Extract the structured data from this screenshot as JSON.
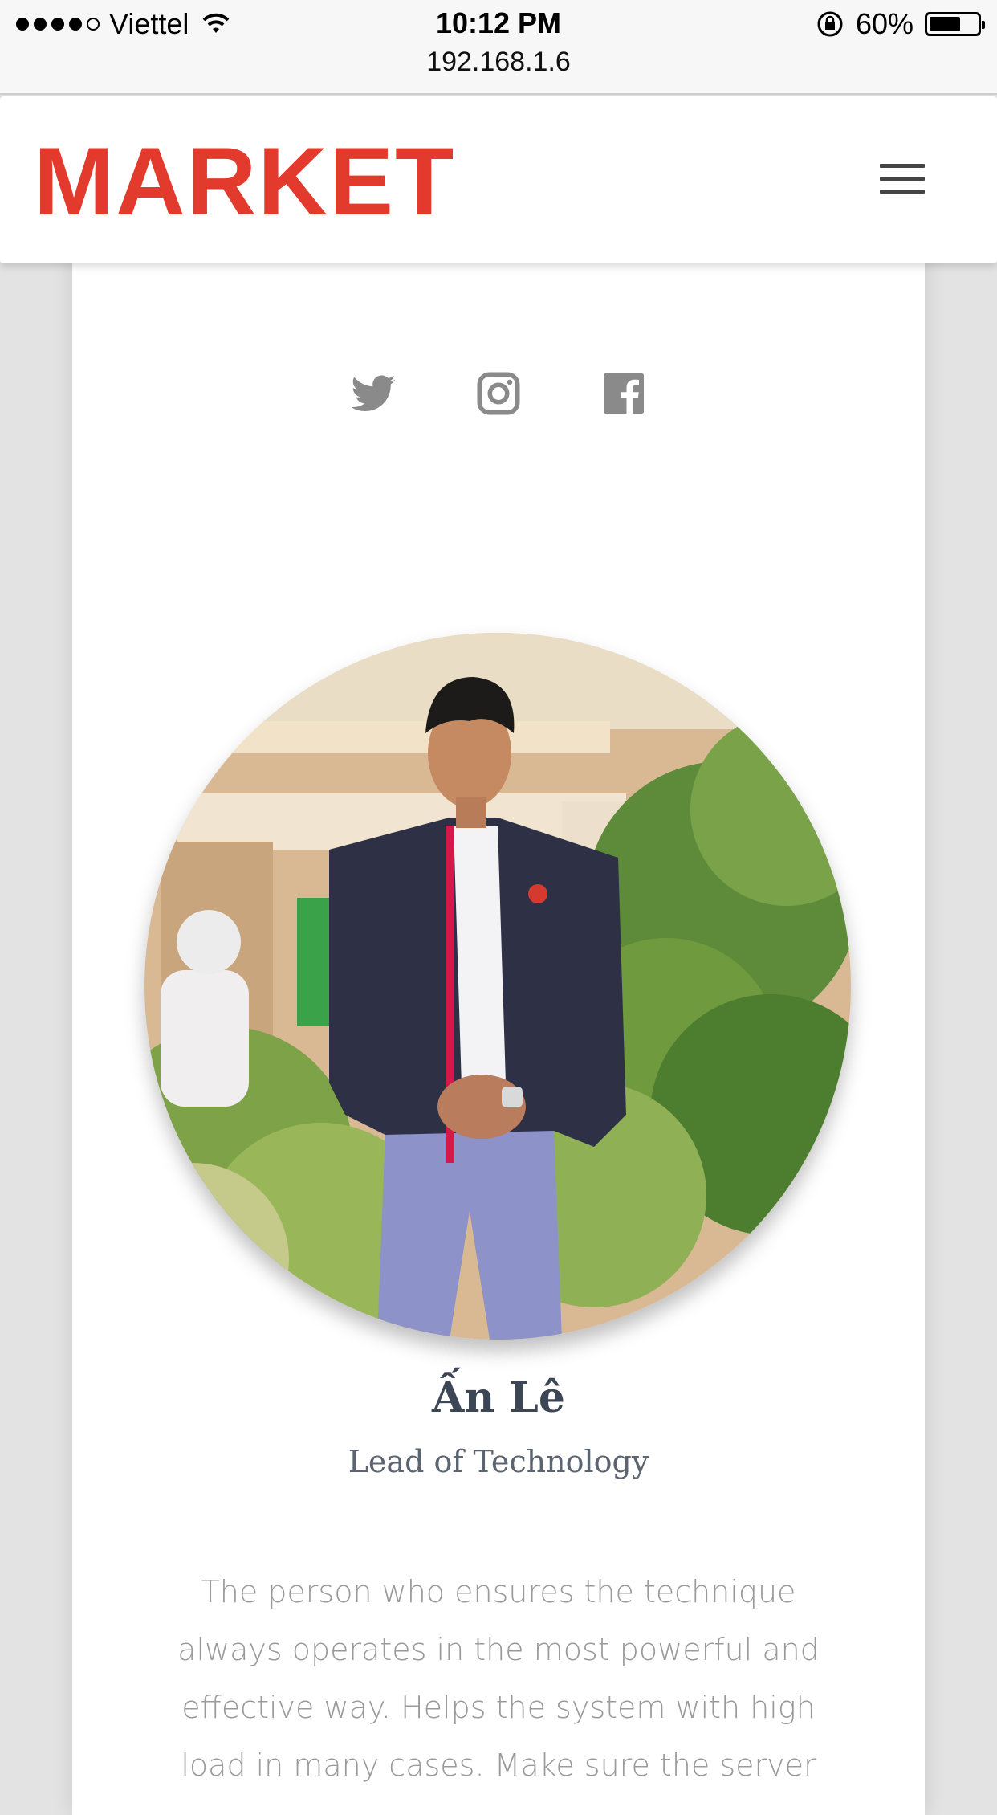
{
  "statusbar": {
    "carrier": "Viettel",
    "time": "10:12 PM",
    "url": "192.168.1.6",
    "battery": "60%",
    "signal_bars": 4,
    "signal_total": 5
  },
  "header": {
    "logo_text": "MARKET",
    "logo_color": "#e23b2e"
  },
  "socials": [
    {
      "name": "twitter-icon"
    },
    {
      "name": "instagram-icon"
    },
    {
      "name": "facebook-icon"
    }
  ],
  "profile": {
    "name": "Ấn Lê",
    "role": "Lead of Technology",
    "bio": "The person who ensures the technique always operates in the most powerful and effective way. Helps the system with high load in many cases. Make sure the server"
  }
}
